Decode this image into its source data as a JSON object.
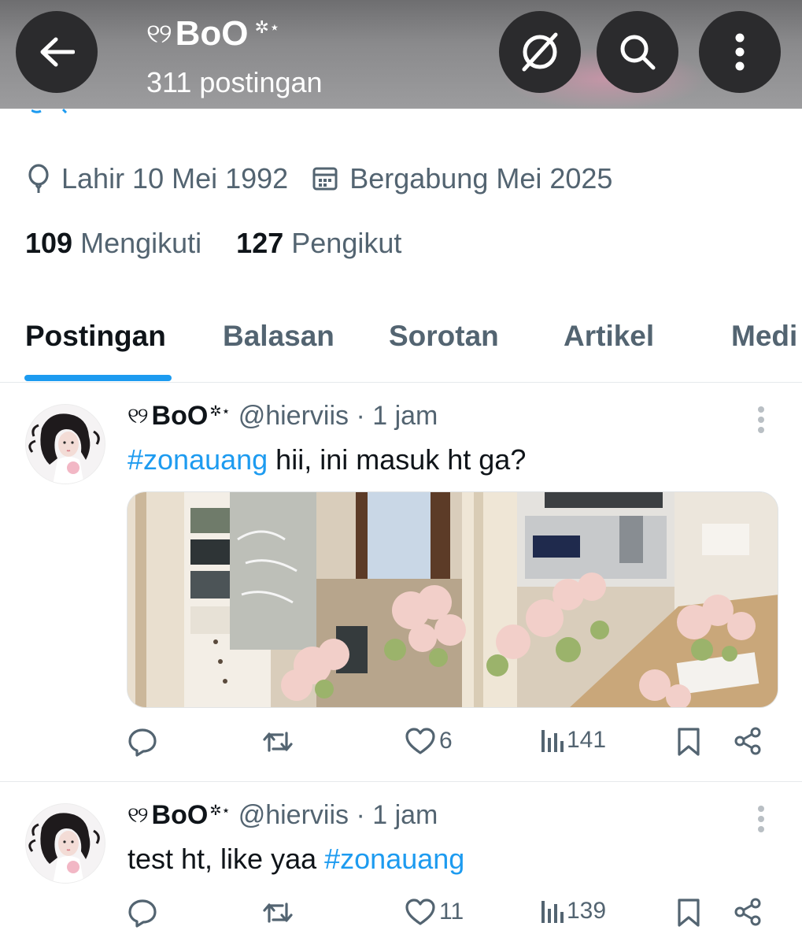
{
  "header": {
    "back_icon": "arrow-left-icon",
    "deco_glyph": "୧୨",
    "display_name": "BoO",
    "stars": "✲⋆",
    "post_count": "311 postingan",
    "grok_icon": "grok-slash-icon",
    "search_icon": "search-icon",
    "more_icon": "more-vertical-icon"
  },
  "profile": {
    "birth_label": "Lahir 10 Mei 1992",
    "joined_label": "Bergabung Mei 2025",
    "following_count": "109",
    "following_label": "Mengikuti",
    "followers_count": "127",
    "followers_label": "Pengikut"
  },
  "tabs": [
    {
      "label": "Postingan",
      "active": true
    },
    {
      "label": "Balasan",
      "active": false
    },
    {
      "label": "Sorotan",
      "active": false
    },
    {
      "label": "Artikel",
      "active": false
    },
    {
      "label": "Medi",
      "active": false
    }
  ],
  "posts": [
    {
      "deco": "୧୨",
      "name": "BoO",
      "stars": "✲⋆",
      "handle": "@hierviis · 1 jam",
      "hashtag": "#zonauang",
      "text": " hii, ini masuk ht ga?",
      "has_media": true,
      "likes": "6",
      "views": "141"
    },
    {
      "deco": "୧୨",
      "name": "BoO",
      "stars": "✲⋆",
      "handle": "@hierviis · 1 jam",
      "text": "test ht, like yaa ",
      "hashtag": "#zonauang",
      "likes": "11",
      "views": "139"
    }
  ],
  "colors": {
    "accent": "#1d9bf0",
    "text_primary": "#0f1419",
    "text_secondary": "#536471",
    "header_button": "#2b2b2d"
  }
}
